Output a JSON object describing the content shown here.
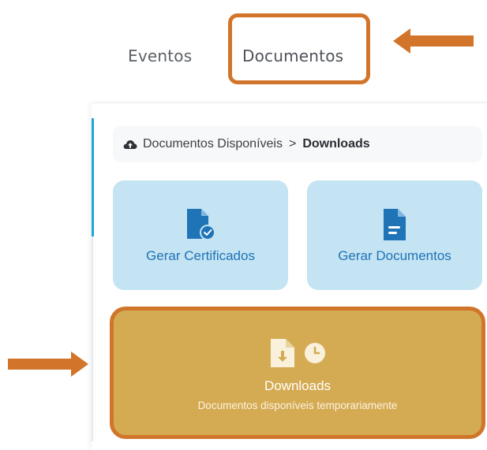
{
  "tabs": [
    {
      "label": "Eventos"
    },
    {
      "label": "Documentos"
    }
  ],
  "breadcrumb": {
    "icon": "cloud-upload-icon",
    "parent": "Documentos Disponíveis",
    "separator": ">",
    "current": "Downloads"
  },
  "cards": {
    "certificates": {
      "label": "Gerar Certificados",
      "icon": "certificate-file-icon"
    },
    "documents": {
      "label": "Gerar Documentos",
      "icon": "document-icon"
    },
    "downloads": {
      "title": "Downloads",
      "subtitle": "Documentos disponíveis temporariamente",
      "icons": [
        "file-download-icon",
        "clock-icon"
      ]
    }
  },
  "annotations": {
    "highlight_color": "#d2752b",
    "arrows": [
      "arrow-pointing-left",
      "arrow-pointing-right"
    ]
  },
  "colors": {
    "card_blue": "#c4e3f3",
    "card_blue_text": "#1f73b7",
    "downloads_card": "#d4ab52",
    "accent_bar": "#21a3d8"
  }
}
